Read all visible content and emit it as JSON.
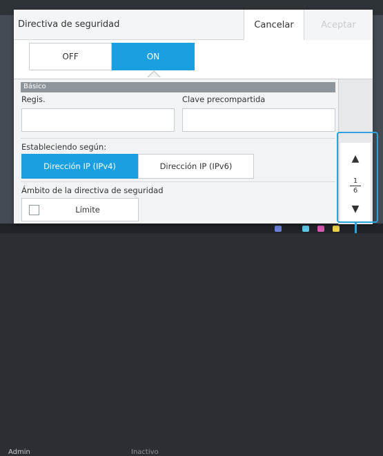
{
  "dialog": {
    "title": "Directiva de seguridad",
    "cancel_label": "Cancelar",
    "accept_label": "Aceptar"
  },
  "toggle": {
    "off_label": "OFF",
    "on_label": "ON",
    "selected": "ON"
  },
  "basic": {
    "section_label": "Básico",
    "regis_label": "Regis.",
    "regis_value": "",
    "preshared_key_label": "Clave precompartida",
    "preshared_key_value": ""
  },
  "established": {
    "label": "Estableciendo según:",
    "options": [
      "Dirección IP (IPv4)",
      "Dirección IP (IPv6)"
    ],
    "selected": "Dirección IP (IPv4)"
  },
  "scope": {
    "label": "Ámbito de la directiva de seguridad",
    "limit_label": "Límite",
    "limit_checked": false
  },
  "pager": {
    "current": "1",
    "total": "6"
  },
  "background": {
    "user_label": "Admin",
    "status_label": "Inactivo"
  },
  "colors": {
    "accent": "#1a9fe0",
    "highlight_frame": "#2ba3df",
    "section_header": "#8e959b"
  }
}
